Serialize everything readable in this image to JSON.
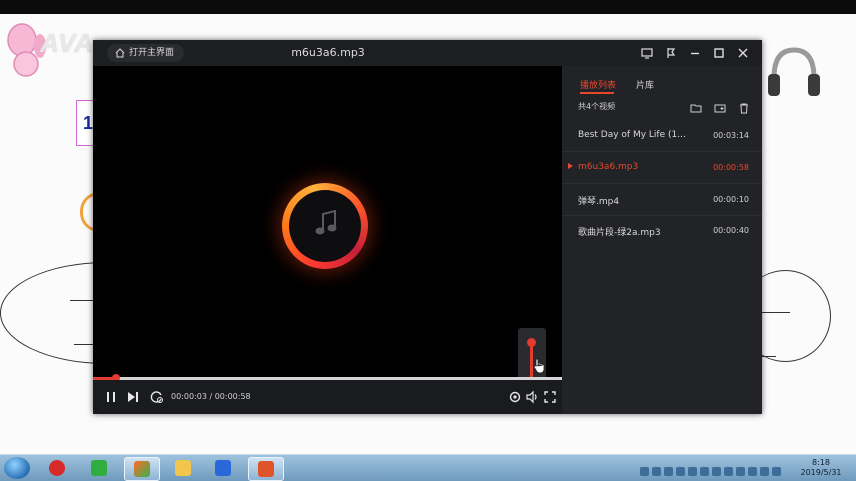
{
  "player": {
    "home_button": "打开主界面",
    "file_title": "m6u3a6.mp3",
    "window_controls": [
      "screen-icon",
      "pin-icon",
      "minimize-icon",
      "maximize-icon",
      "close-icon"
    ],
    "playback": {
      "current_time": "00:00:03",
      "duration": "00:00:58",
      "time_display": "00:00:03 / 00:00:58",
      "progress_fraction": 0.05,
      "volume_fraction": 0.95
    }
  },
  "playlist": {
    "tabs": [
      {
        "label": "播放列表",
        "active": true
      },
      {
        "label": "片库",
        "active": false
      }
    ],
    "count_label": "共4个视频",
    "items": [
      {
        "name": "Best Day of My Life (1...",
        "duration": "00:03:14",
        "active": false
      },
      {
        "name": "m6u3a6.mp3",
        "duration": "00:00:58",
        "active": true
      },
      {
        "name": "弹琴.mp4",
        "duration": "00:00:10",
        "active": false
      },
      {
        "name": "歌曲片段-绿2a.mp3",
        "duration": "00:00:40",
        "active": false
      }
    ]
  },
  "taskbar": {
    "clock_time": "8:18",
    "clock_date": "2019/5/31"
  },
  "background": {
    "slide_number": "1"
  },
  "colors": {
    "accent": "#e8472e",
    "window_bg": "#111214",
    "panel_bg": "#222326"
  }
}
